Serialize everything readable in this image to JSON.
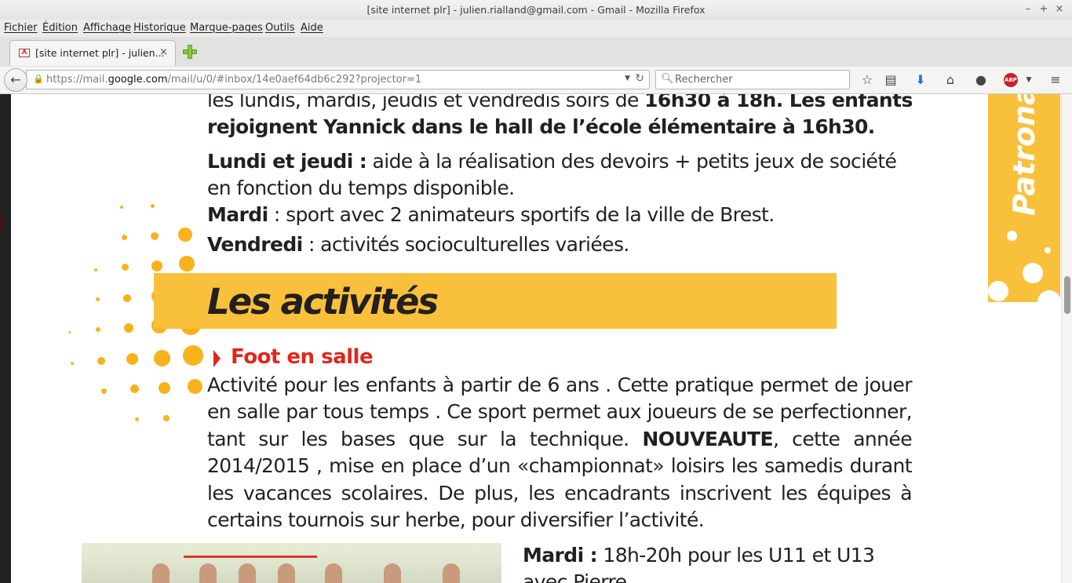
{
  "window": {
    "title": "[site internet plr] - julien.rialland@gmail.com - Gmail - Mozilla Firefox",
    "controls": [
      "–",
      "+",
      "×"
    ]
  },
  "menu": [
    "Fichier",
    "Édition",
    "Affichage",
    "Historique",
    "Marque-pages",
    "Outils",
    "Aide"
  ],
  "tab": {
    "title": "[site internet plr] - julien...",
    "close": "×"
  },
  "nav": {
    "url_prefix": "https://mail.",
    "url_domain": "google.com",
    "url_path": "/mail/u/0/#inbox/14e0aef64db6c292?projector=1",
    "search_placeholder": "Rechercher"
  },
  "colors": {
    "accent_yellow": "#f9c13b",
    "dot_yellow": "#f9b21b",
    "heading_red": "#e1261c",
    "text": "#231f20"
  },
  "document": {
    "intro_line1_plain": "les lundis, mardis, jeudis et vendredis soirs de ",
    "intro_line1_bold": "16h30 à 18h. Les enfants",
    "intro_line2_bold": "rejoignent Yannick dans le hall de l’école élémentaire à 16h30.",
    "lundi_label": "Lundi et jeudi :",
    "lundi_text": " aide à la réalisation des devoirs + petits jeux de société",
    "lundi_text2": "en fonction du temps disponible.",
    "mardi_label": "Mardi",
    "mardi_text": " : sport avec 2 animateurs sportifs de la ville de Brest.",
    "vendredi_label": "Vendredi",
    "vendredi_text": " : activités socioculturelles variées.",
    "section_title": "Les activités",
    "sub_title": "Foot en salle",
    "para": [
      "Activité pour les enfants à partir de 6 ans . Cette pratique permet de jouer",
      "en salle par tous temps . Ce sport permet aux joueurs de se perfectionner,",
      "tant sur les bases que sur la technique.",
      "NOUVEAUTE",
      ", cette année",
      "2014/2015 , mise en place d’un «championnat» loisirs les samedis durant",
      "les vacances scolaires. De plus, les encadrants inscrivent les équipes à",
      "certains tournois sur herbe, pour diversifier l’activité."
    ],
    "schedule_label": "Mardi :",
    "schedule_text": " 18h-20h  pour les U11 et U13",
    "schedule_line2": "avec Pierre",
    "side_banner": "Patronage"
  }
}
